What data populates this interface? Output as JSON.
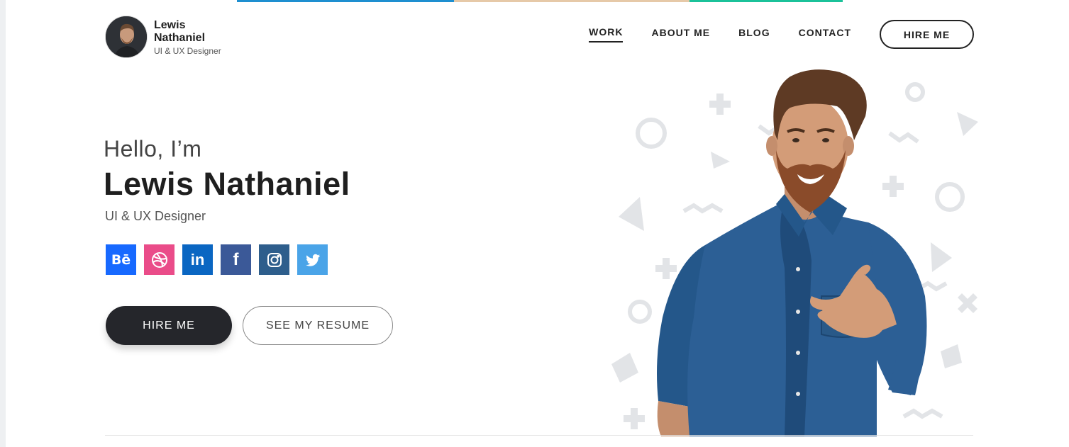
{
  "brand": {
    "name": "Lewis Nathaniel",
    "role": "UI & UX Designer"
  },
  "nav": {
    "items": [
      "WORK",
      "ABOUT ME",
      "BLOG",
      "CONTACT"
    ],
    "cta": "HIRE ME"
  },
  "hero": {
    "greeting": "Hello, I’m",
    "name": "Lewis Nathaniel",
    "role": "UI & UX Designer",
    "primary_button": "HIRE ME",
    "secondary_button": "SEE MY RESUME"
  },
  "socials": [
    {
      "label": "Bē",
      "icon": "behance-icon",
      "color": "#1769ff"
    },
    {
      "label": "dribbble",
      "icon": "dribbble-icon",
      "color": "#ea4c89"
    },
    {
      "label": "in",
      "icon": "linkedin-icon",
      "color": "#0a66c2"
    },
    {
      "label": "f",
      "icon": "facebook-icon",
      "color": "#3b5998"
    },
    {
      "label": "instagram",
      "icon": "instagram-icon",
      "color": "#2e5e8c"
    },
    {
      "label": "twitter",
      "icon": "twitter-icon",
      "color": "#4aa4e8"
    }
  ],
  "colors": {
    "primary_dark": "#25262b",
    "accent_blue": "#1e8fd0",
    "accent_green": "#1bc29a"
  }
}
